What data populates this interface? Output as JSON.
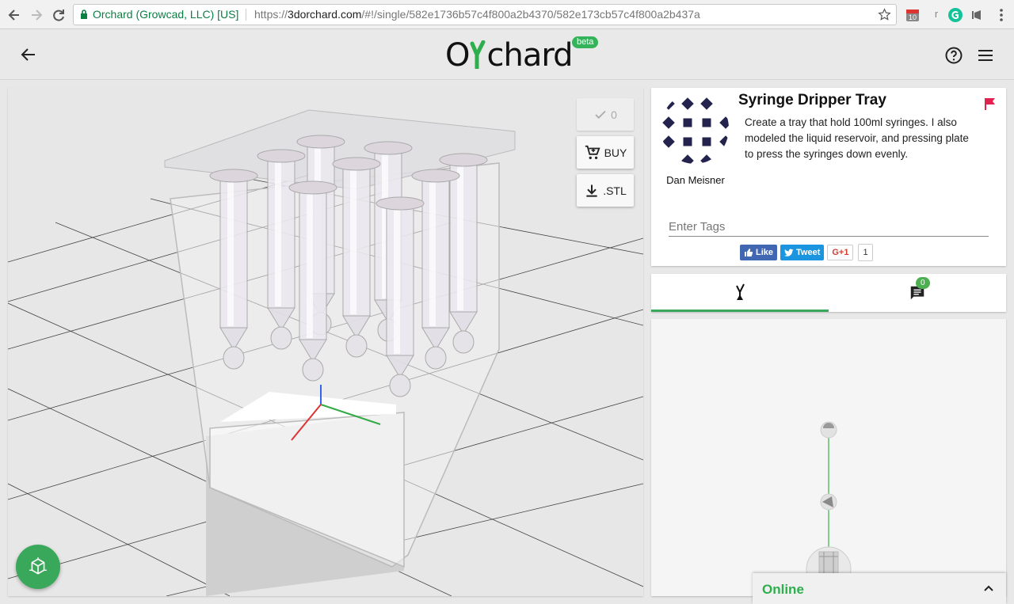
{
  "browser": {
    "secure_label": "Orchard (Growcad, LLC) [US]",
    "url_prefix": "https://",
    "url_domain": "3dorchard.com",
    "url_path": "/#!/single/582e1736b57c4f800a2b4370/582e173cb57c4f800a2b437a",
    "extension_badge": "10",
    "extension_letter": "r"
  },
  "header": {
    "logo_text_prefix": "O",
    "logo_text_suffix": "chard",
    "beta_label": "beta"
  },
  "viewer": {
    "likes_count": "0",
    "buy_label": "BUY",
    "stl_label": ".STL"
  },
  "model": {
    "title": "Syringe Dripper Tray",
    "description": "Create a tray that hold 100ml syringes. I also modeled the liquid reservoir, and pressing plate to press the syringes down evenly.",
    "author": "Dan Meisner",
    "tags_placeholder": "Enter Tags"
  },
  "social": {
    "like_label": "Like",
    "tweet_label": "Tweet",
    "gplus_label": "G+1",
    "gplus_count": "1"
  },
  "tabs": {
    "comments_badge": "0"
  },
  "status": {
    "online_label": "Online"
  },
  "colors": {
    "brand_green": "#3aa85a",
    "flag_red": "#e0224e",
    "avatar_navy": "#23234e"
  }
}
